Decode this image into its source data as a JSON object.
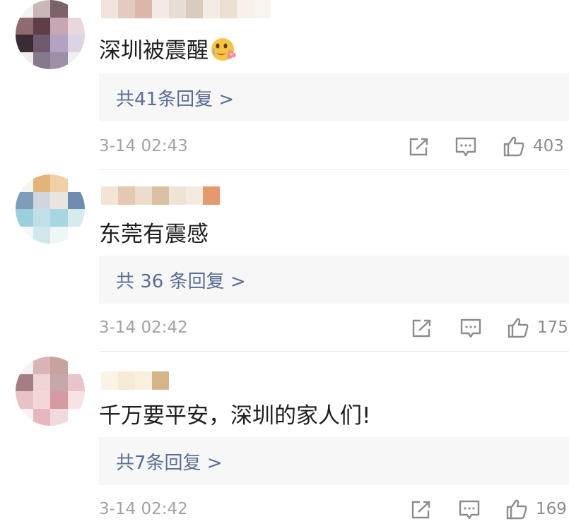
{
  "comments": [
    {
      "text": "深圳被震醒",
      "emoji_icon": "crying-face-with-flower-emoji",
      "replies_label": "共41条回复 >",
      "time": "3-14 02:43",
      "likes": "403"
    },
    {
      "text": "东莞有震感",
      "replies_label": "共 36 条回复 >",
      "time": "3-14 02:42",
      "likes": "175"
    },
    {
      "text": "千万要平安，深圳的家人们!",
      "replies_label": "共7条回复 >",
      "time": "3-14 02:42",
      "likes": "169"
    }
  ],
  "icons": {
    "repost": "share-square-icon",
    "comment": "comment-bubble-icon",
    "like": "thumbs-up-icon"
  },
  "colors": {
    "link": "#5b6d94",
    "meta": "#a3a3a3",
    "reply_bg": "#f7f7f7"
  }
}
